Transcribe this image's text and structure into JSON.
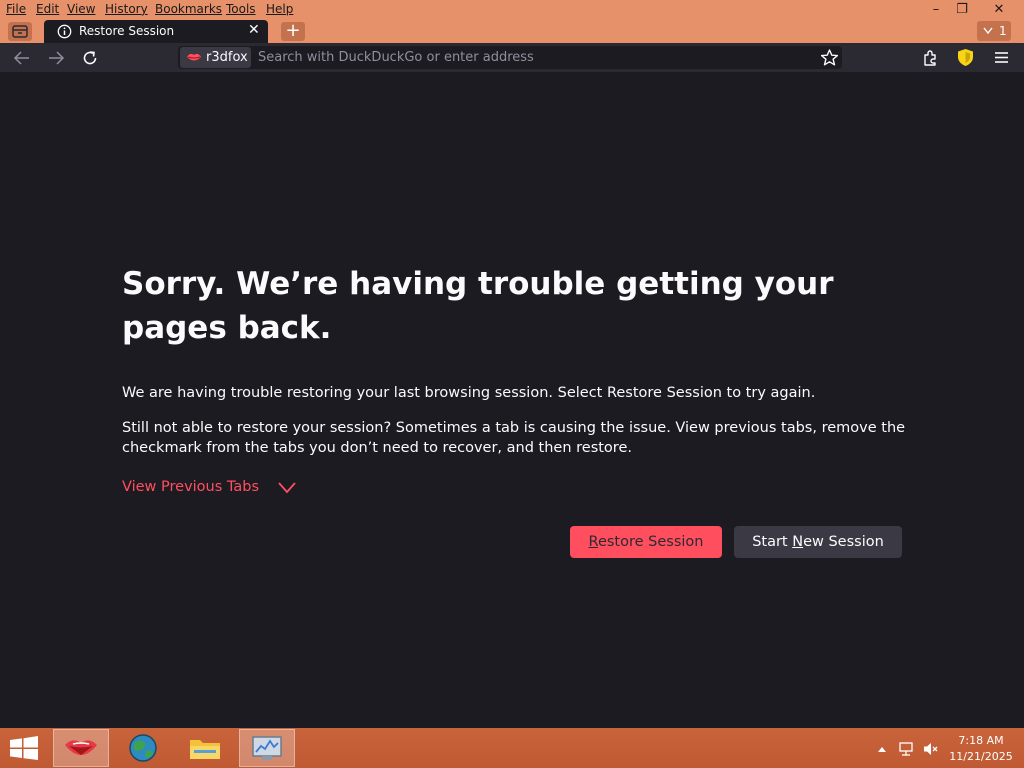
{
  "menu": [
    "File",
    "Edit",
    "View",
    "History",
    "Bookmarks",
    "Tools",
    "Help"
  ],
  "window_controls": {
    "minimize": "–",
    "restore": "❐",
    "close": "✕"
  },
  "tab": {
    "title": "Restore Session",
    "close": "✕"
  },
  "new_tab": "+",
  "tab_count": "1",
  "url": {
    "identity": "r3dfox",
    "placeholder": "Search with DuckDuckGo or enter address"
  },
  "content": {
    "title": "Sorry. We’re having trouble getting your pages back.",
    "p1": "We are having trouble restoring your last browsing session. Select Restore Session to try again.",
    "p2": "Still not able to restore your session? Sometimes a tab is causing the issue. View previous tabs, remove the checkmark from the tabs you don’t need to recover, and then restore.",
    "view_prev": "View Previous Tabs",
    "restore_btn": {
      "accel": "R",
      "rest": "estore Session"
    },
    "new_btn": {
      "pre": "Start ",
      "accel": "N",
      "rest": "ew Session"
    }
  },
  "clock": {
    "time": "7:18 AM",
    "date": "11/21/2025"
  },
  "colors": {
    "menubar": "#e7916a",
    "page_bg": "#1c1b22",
    "toolbar": "#2b2a33",
    "accent": "#ff4f5e",
    "taskbar": "#c45f36"
  }
}
